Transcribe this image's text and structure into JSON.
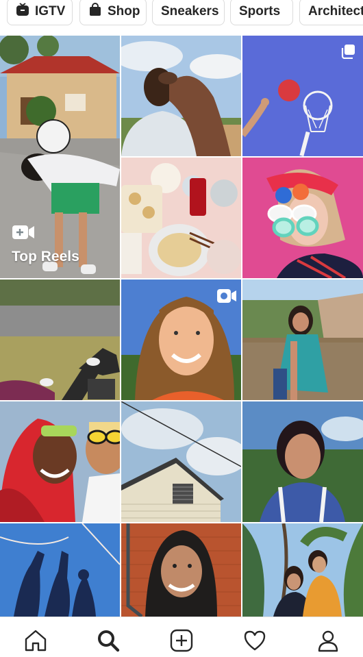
{
  "categories": [
    {
      "label": "IGTV",
      "icon": "igtv-icon"
    },
    {
      "label": "Shop",
      "icon": "shopping-bag-icon"
    },
    {
      "label": "Sneakers",
      "icon": ""
    },
    {
      "label": "Sports",
      "icon": ""
    },
    {
      "label": "Architect",
      "icon": ""
    }
  ],
  "feature_tile": {
    "label": "Top Reels",
    "icon": "reels-icon"
  },
  "tabbar": [
    {
      "name": "home",
      "icon": "home-icon"
    },
    {
      "name": "search",
      "icon": "search-icon",
      "active": true
    },
    {
      "name": "create",
      "icon": "add-post-icon"
    },
    {
      "name": "activity",
      "icon": "heart-icon"
    },
    {
      "name": "profile",
      "icon": "profile-icon"
    }
  ]
}
